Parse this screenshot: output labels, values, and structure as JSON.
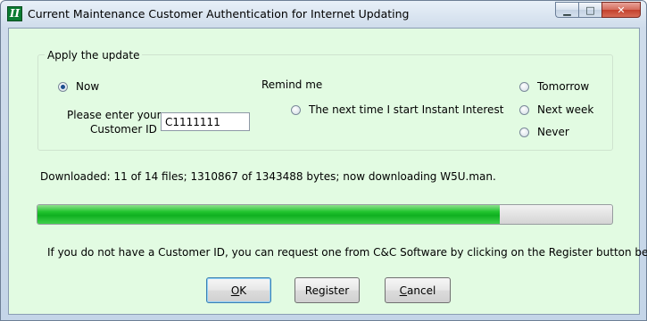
{
  "window": {
    "title": "Current Maintenance Customer Authentication for Internet Updating",
    "app_icon_glyph": "II",
    "controls": {
      "minimize": "▁",
      "maximize": "□",
      "close": "✕"
    }
  },
  "apply_group": {
    "legend": "Apply the update",
    "now_option": {
      "label": "Now",
      "checked": true
    },
    "customer_id_label_line1": "Please enter your",
    "customer_id_label_line2": "Customer ID",
    "customer_id_value": "C1111111",
    "remind_label": "Remind me",
    "next_time_option": {
      "label": "The next time I start Instant Interest",
      "checked": false
    },
    "tomorrow_option": {
      "label": "Tomorrow",
      "checked": false
    },
    "next_week_option": {
      "label": "Next week",
      "checked": false
    },
    "never_option": {
      "label": "Never",
      "checked": false
    }
  },
  "status": {
    "text": "Downloaded:  11 of  14 files;  1310867 of  1343488 bytes; now downloading W5U.man.",
    "progress_fraction": 0.805
  },
  "info_text": "If you do not have a Customer ID, you can request one from C&C Software by clicking on the Register button below.",
  "buttons": {
    "ok": {
      "underlined": "O",
      "rest": "K"
    },
    "register": "Register",
    "cancel": {
      "underlined": "C",
      "rest": "ancel"
    }
  }
}
